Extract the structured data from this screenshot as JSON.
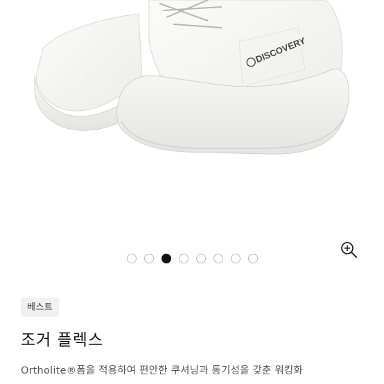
{
  "product": {
    "badge": "베스트",
    "title": "조거 플렉스",
    "description": "Ortholite®폼을 적용하여 편안한 쿠셔닝과 통기성을 갖춘 워킹화",
    "image_logo_text": "DISCOVERY"
  },
  "gallery": {
    "total_slides": 8,
    "active_slide": 3,
    "zoom_icon": "zoom-in-icon",
    "accent_color": "#111111",
    "inactive_dot_color": "#b9b9b9"
  }
}
